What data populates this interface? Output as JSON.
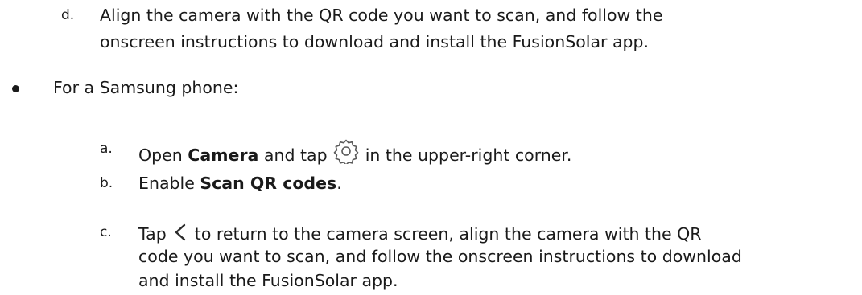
{
  "items": {
    "d": {
      "marker": "d.",
      "line1": "Align the camera with the QR code you want to scan, and follow the",
      "line2": "onscreen instructions to download and install the FusionSolar app."
    },
    "samsung": {
      "text": "For a Samsung phone:"
    },
    "a": {
      "marker": "a.",
      "pre": "Open",
      "bold": "Camera",
      "mid": "and tap",
      "post": "in the upper-right corner.",
      "icon": "settings-gear-icon"
    },
    "b": {
      "marker": "b.",
      "pre": "Enable",
      "bold": "Scan QR codes",
      "post": "."
    },
    "c": {
      "marker": "c.",
      "pre": "Tap",
      "icon": "back-chevron-icon",
      "line1_post": "to return to the camera screen, align the camera with the QR",
      "line2": "code you want to scan, and follow the onscreen instructions to download",
      "line3": "and install the FusionSolar app."
    }
  }
}
